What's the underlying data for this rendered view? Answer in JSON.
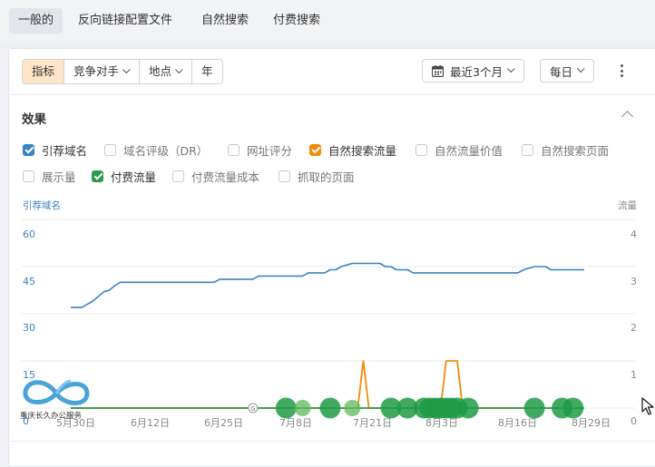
{
  "top_tabs": [
    {
      "label": "一般的",
      "active": true
    },
    {
      "label": "反向链接配置文件",
      "active": false
    },
    {
      "label": "自然搜索",
      "active": false
    },
    {
      "label": "付费搜索",
      "active": false
    }
  ],
  "toolbar": {
    "segments": [
      {
        "label": "指标",
        "active": true,
        "dropdown": false
      },
      {
        "label": "竞争对手",
        "active": false,
        "dropdown": true
      },
      {
        "label": "地点",
        "active": false,
        "dropdown": true
      },
      {
        "label": "年",
        "active": false,
        "dropdown": false
      }
    ],
    "date_range": "最近3个月",
    "granularity": "每日"
  },
  "section": {
    "title": "效果"
  },
  "metrics": [
    {
      "label": "引荐域名",
      "checked": true,
      "color": "#3b82c4"
    },
    {
      "label": "域名评级（DR）",
      "checked": false
    },
    {
      "label": "网址评分",
      "checked": false
    },
    {
      "label": "自然搜索流量",
      "checked": true,
      "color": "#f08c0a"
    },
    {
      "label": "自然流量价值",
      "checked": false
    },
    {
      "label": "自然搜索页面",
      "checked": false
    },
    {
      "label": "展示量",
      "checked": false
    },
    {
      "label": "付费流量",
      "checked": true,
      "color": "#2e9a4e"
    },
    {
      "label": "付费流量成本",
      "checked": false
    },
    {
      "label": "抓取的页面",
      "checked": false
    }
  ],
  "watermark": {
    "text": "重庆长久办公服务"
  },
  "chart_data": {
    "type": "line",
    "left_axis": {
      "label": "引荐域名",
      "ticks": [
        "60",
        "45",
        "30",
        "15",
        "0"
      ],
      "ylim": [
        0,
        60
      ]
    },
    "right_axis": {
      "label": "流量",
      "ticks": [
        "4",
        "3",
        "2",
        "1",
        "0"
      ],
      "ylim": [
        0,
        4
      ]
    },
    "x_tick_labels": [
      "5月30日",
      "6月12日",
      "6月25日",
      "7月8日",
      "7月21日",
      "8月3日",
      "8月16日",
      "8月29日"
    ],
    "x_range": [
      0,
      94
    ],
    "x_tick_positions": [
      0,
      13,
      26,
      39,
      52,
      65,
      78,
      91
    ],
    "series": [
      {
        "name": "引荐域名",
        "axis": "left",
        "color": "#3b82c4",
        "points": [
          [
            0,
            32
          ],
          [
            2,
            32
          ],
          [
            4,
            34
          ],
          [
            6,
            37
          ],
          [
            7,
            37.5
          ],
          [
            8,
            39
          ],
          [
            9,
            40
          ],
          [
            10,
            40
          ],
          [
            20,
            40
          ],
          [
            26,
            40
          ],
          [
            27,
            41
          ],
          [
            33,
            41
          ],
          [
            34,
            42
          ],
          [
            42,
            42
          ],
          [
            43,
            43
          ],
          [
            46,
            43
          ],
          [
            47,
            44
          ],
          [
            48,
            44
          ],
          [
            49,
            45
          ],
          [
            51,
            46
          ],
          [
            56,
            46
          ],
          [
            57,
            45
          ],
          [
            58,
            45
          ],
          [
            59,
            44
          ],
          [
            61,
            44
          ],
          [
            62,
            43
          ],
          [
            81,
            43
          ],
          [
            82,
            44
          ],
          [
            84,
            45
          ],
          [
            86,
            45
          ],
          [
            87,
            44
          ],
          [
            93,
            44
          ]
        ]
      },
      {
        "name": "自然搜索流量",
        "axis": "right",
        "color": "#f08c0a",
        "points": [
          [
            0,
            0
          ],
          [
            52,
            0
          ],
          [
            53,
            1
          ],
          [
            54,
            0
          ],
          [
            67,
            0
          ],
          [
            68,
            1
          ],
          [
            70,
            1
          ],
          [
            71,
            0
          ],
          [
            93,
            0
          ]
        ]
      },
      {
        "name": "付费流量",
        "axis": "right",
        "color": "#2e9a4e",
        "points": [
          [
            0,
            0
          ],
          [
            93,
            0
          ]
        ]
      }
    ],
    "paid_markers_x": [
      39,
      42,
      47,
      51,
      58,
      61,
      64,
      65,
      66,
      67,
      68,
      69,
      70,
      72,
      84,
      89,
      91
    ],
    "annotation_marker_x": 33
  }
}
